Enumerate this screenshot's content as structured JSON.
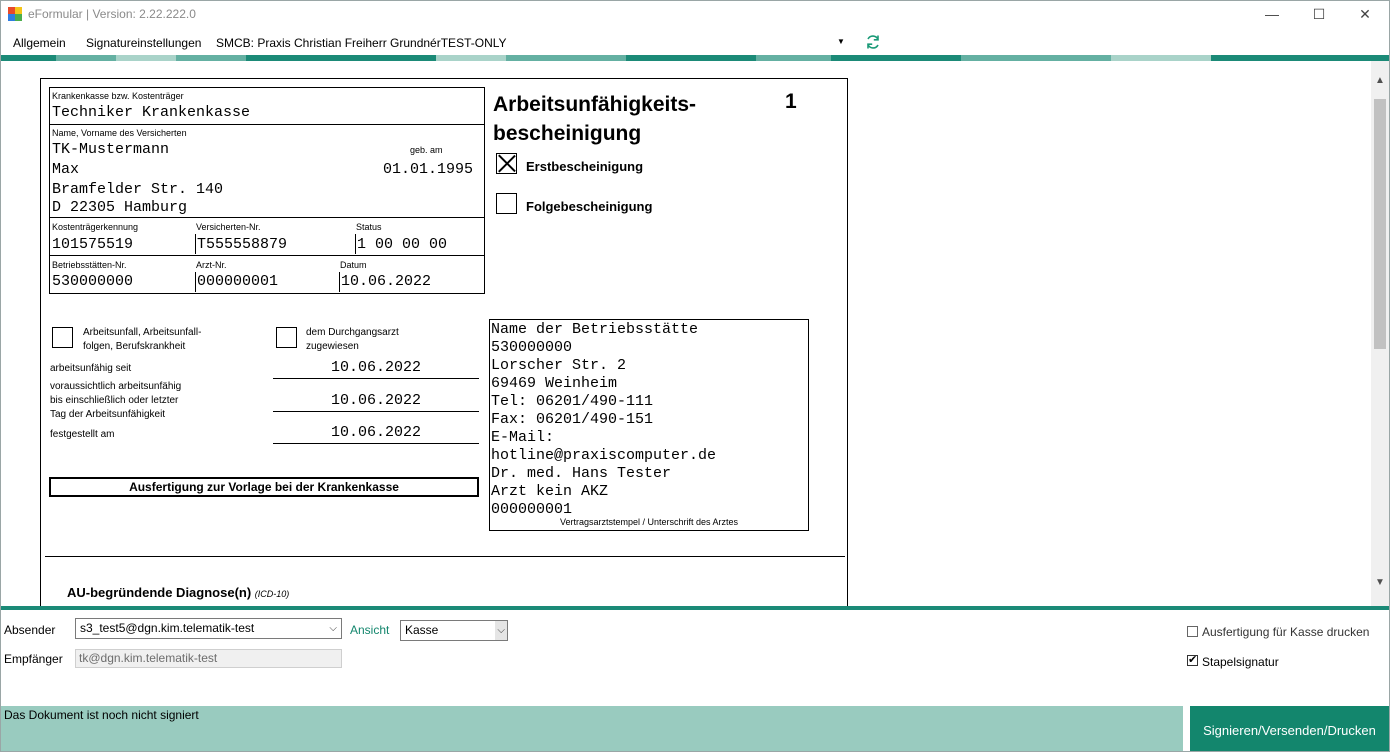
{
  "window": {
    "title": "eFormular | Version: 2.22.222.0",
    "minimize": "—",
    "maximize": "☐",
    "close": "✕"
  },
  "menu": {
    "general": "Allgemein",
    "signature_settings": "Signatureinstellungen",
    "smcb": "SMCB: Praxis Christian Freiherr GrundnérTEST-ONLY"
  },
  "colors": {
    "accent": "#13866d",
    "stripe_dark": "#1b8a77",
    "stripe_mid": "#64b0a2",
    "stripe_light": "#a9d3c9",
    "status_bar": "#99cbbf"
  },
  "form": {
    "insurer_label": "Krankenkasse bzw. Kostenträger",
    "insurer": "Techniker Krankenkasse",
    "name_label": "Name, Vorname des Versicherten",
    "last_name": "TK-Mustermann",
    "birth_label": "geb. am",
    "first_name": "Max",
    "birth_date": "01.01.1995",
    "street": "Bramfelder Str. 140",
    "city": "D 22305 Hamburg",
    "payer_id_label": "Kostenträgerkennung",
    "payer_id": "101575519",
    "insured_no_label": "Versicherten-Nr.",
    "insured_no": "T555558879",
    "status_label": "Status",
    "status": "1 00 00 00",
    "site_no_label": "Betriebsstätten-Nr.",
    "site_no": "530000000",
    "doctor_no_label": "Arzt-Nr.",
    "doctor_no": "000000001",
    "date_label": "Datum",
    "date": "10.06.2022",
    "title_line1": "Arbeitsunfähigkeits-",
    "title_line2": "bescheinigung",
    "page_number": "1",
    "first_cert": "Erstbescheinigung",
    "first_cert_checked": true,
    "followup_cert": "Folgebescheinigung",
    "followup_cert_checked": false,
    "accident_line1": "Arbeitsunfall, Arbeitsunfall-",
    "accident_line2": "folgen, Berufskrankheit",
    "transit_line1": "dem Durchgangsarzt",
    "transit_line2": "zugewiesen",
    "unfit_since_label": "arbeitsunfähig seit",
    "unfit_since": "10.06.2022",
    "until_line1": "voraussichtlich arbeitsunfähig",
    "until_line2": "bis einschließlich oder letzter",
    "until_line3": "Tag der Arbeitsunfähigkeit",
    "until": "10.06.2022",
    "determined_label": "festgestellt am",
    "determined": "10.06.2022",
    "copy_note": "Ausfertigung zur Vorlage bei der Krankenkasse",
    "stamp_lines": [
      "Name der Betriebsstätte",
      "530000000",
      "Lorscher Str.  2",
      "69469 Weinheim",
      "Tel: 06201/490-111",
      "Fax: 06201/490-151",
      "E-Mail:",
      "hotline@praxiscomputer.de",
      "Dr. med. Hans Tester",
      "Arzt kein AKZ",
      "000000001"
    ],
    "stamp_caption": "Vertragsarztstempel / Unterschrift des Arztes",
    "diagnosis_label": "AU-begründende Diagnose(n)",
    "diagnosis_code_label": "(ICD-10)"
  },
  "bottom": {
    "sender_label": "Absender",
    "sender_value": "s3_test5@dgn.kim.telematik-test",
    "view_label": "Ansicht",
    "view_value": "Kasse",
    "recipient_label": "Empfänger",
    "recipient_value": "tk@dgn.kim.telematik-test",
    "print_copy_label": "Ausfertigung für Kasse drucken",
    "print_copy_checked": false,
    "batch_sign_label": "Stapelsignatur",
    "batch_sign_checked": true,
    "status_text": "Das Dokument ist noch nicht signiert",
    "sign_button": "Signieren/Versenden/Drucken"
  }
}
